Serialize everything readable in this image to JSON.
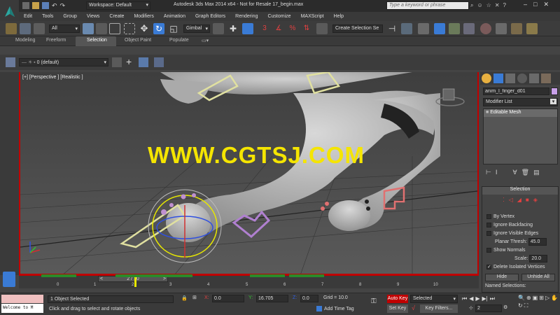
{
  "title_bar": {
    "workspace": "Workspace: Default",
    "title": "Autodesk 3ds Max  2014 x64  -  Not for Resale    17_begin.max",
    "search_placeholder": "Type a keyword or phrase"
  },
  "menu": [
    "Edit",
    "Tools",
    "Group",
    "Views",
    "Create",
    "Modifiers",
    "Animation",
    "Graph Editors",
    "Rendering",
    "Customize",
    "MAXScript",
    "Help"
  ],
  "toolbar": {
    "filter": "All",
    "coord_system": "Gimbal",
    "selection_set": "Create Selection Se"
  },
  "ribbon_tabs": [
    "Modeling",
    "Freeform",
    "Selection",
    "Object Paint",
    "Populate"
  ],
  "ribbon_active": "Selection",
  "layer": {
    "name": "0 (default)"
  },
  "viewport": {
    "label": "[+] [Perspective ] [Realistic ]",
    "watermark": "WWW.CGTSJ.COM"
  },
  "command_panel": {
    "object_name": "anim_l_finger_d01",
    "modifier_list": "Modifier List",
    "stack_item": "Editable Mesh",
    "rollout_title": "Selection",
    "options": [
      {
        "label": "By Vertex",
        "checked": false
      },
      {
        "label": "Ignore Backfacing",
        "checked": false
      },
      {
        "label": "Ignore Visible Edges",
        "checked": false
      }
    ],
    "planar_label": "Planar Thresh:",
    "planar_value": "45.0",
    "show_normals": "Show Normals",
    "scale_label": "Scale:",
    "scale_value": "20.0",
    "delete_isolated": "Delete Isolated Vertices",
    "hide_btn": "Hide",
    "unhide_btn": "Unhide All",
    "named_sel": "Named Selections:"
  },
  "timeline": {
    "frame": "2 / 10",
    "ticks": [
      "0",
      "1",
      "2",
      "3",
      "4",
      "5",
      "6",
      "7",
      "8",
      "9",
      "10"
    ]
  },
  "status": {
    "maxscript": "Welcome to M",
    "selected": "1 Object Selected",
    "prompt": "Click and drag to select and rotate objects",
    "x_label": "X:",
    "x_val": "0.0",
    "y_label": "Y:",
    "y_val": "16.705",
    "z_label": "Z:",
    "z_val": "0.0",
    "grid": "Grid = 10.0",
    "add_time_tag": "Add Time Tag",
    "auto_key": "Auto Key",
    "set_key": "Set Key",
    "key_mode": "Selected",
    "key_filters": "Key Filters...",
    "current_frame": "2"
  },
  "colors": {
    "accent": "#c00000",
    "watermark": "#f5e500",
    "selection_blue": "#3a7bd5"
  }
}
